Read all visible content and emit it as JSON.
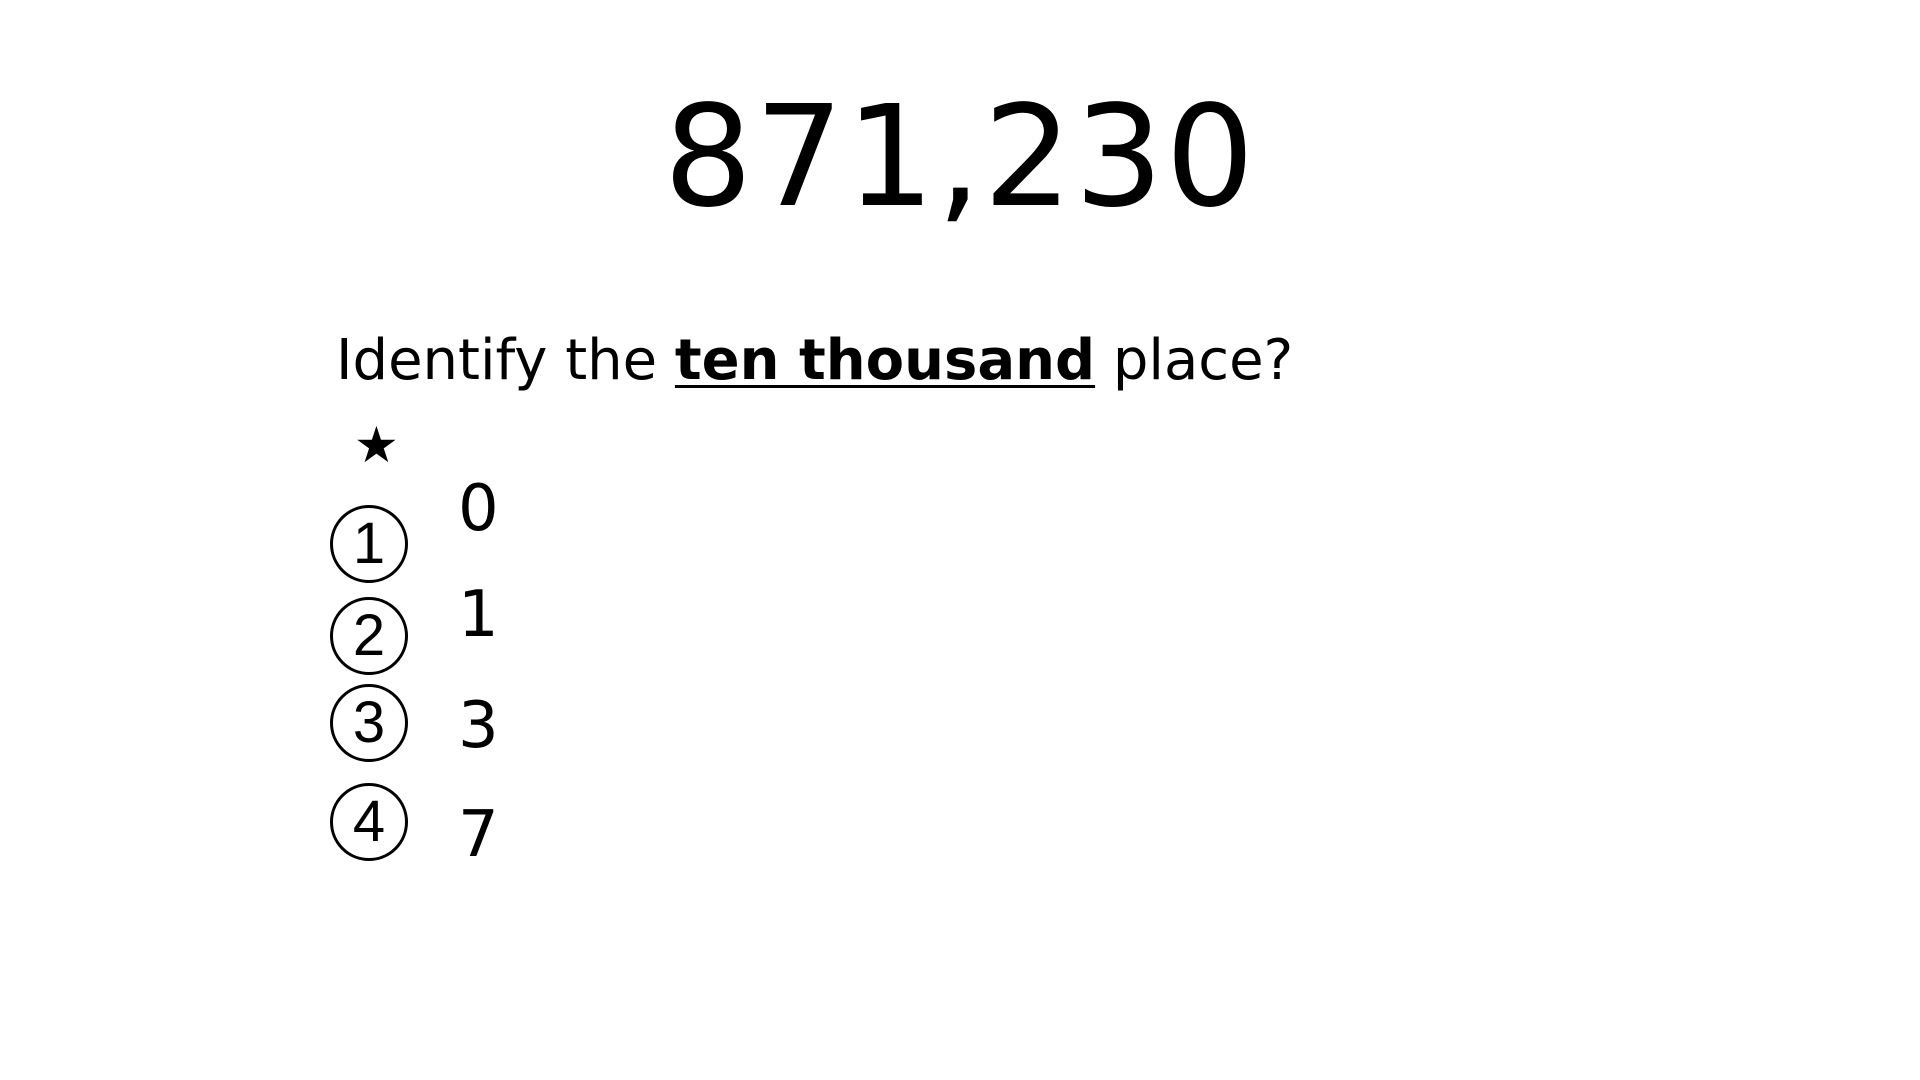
{
  "number": "871,230",
  "question": {
    "prefix": "Identify the ",
    "emphasis": "ten thousand",
    "suffix": " place?"
  },
  "star_glyph": "★",
  "options": [
    {
      "marker": "1",
      "value": "0"
    },
    {
      "marker": "2",
      "value": "1"
    },
    {
      "marker": "3",
      "value": "3"
    },
    {
      "marker": "4",
      "value": "7"
    }
  ]
}
